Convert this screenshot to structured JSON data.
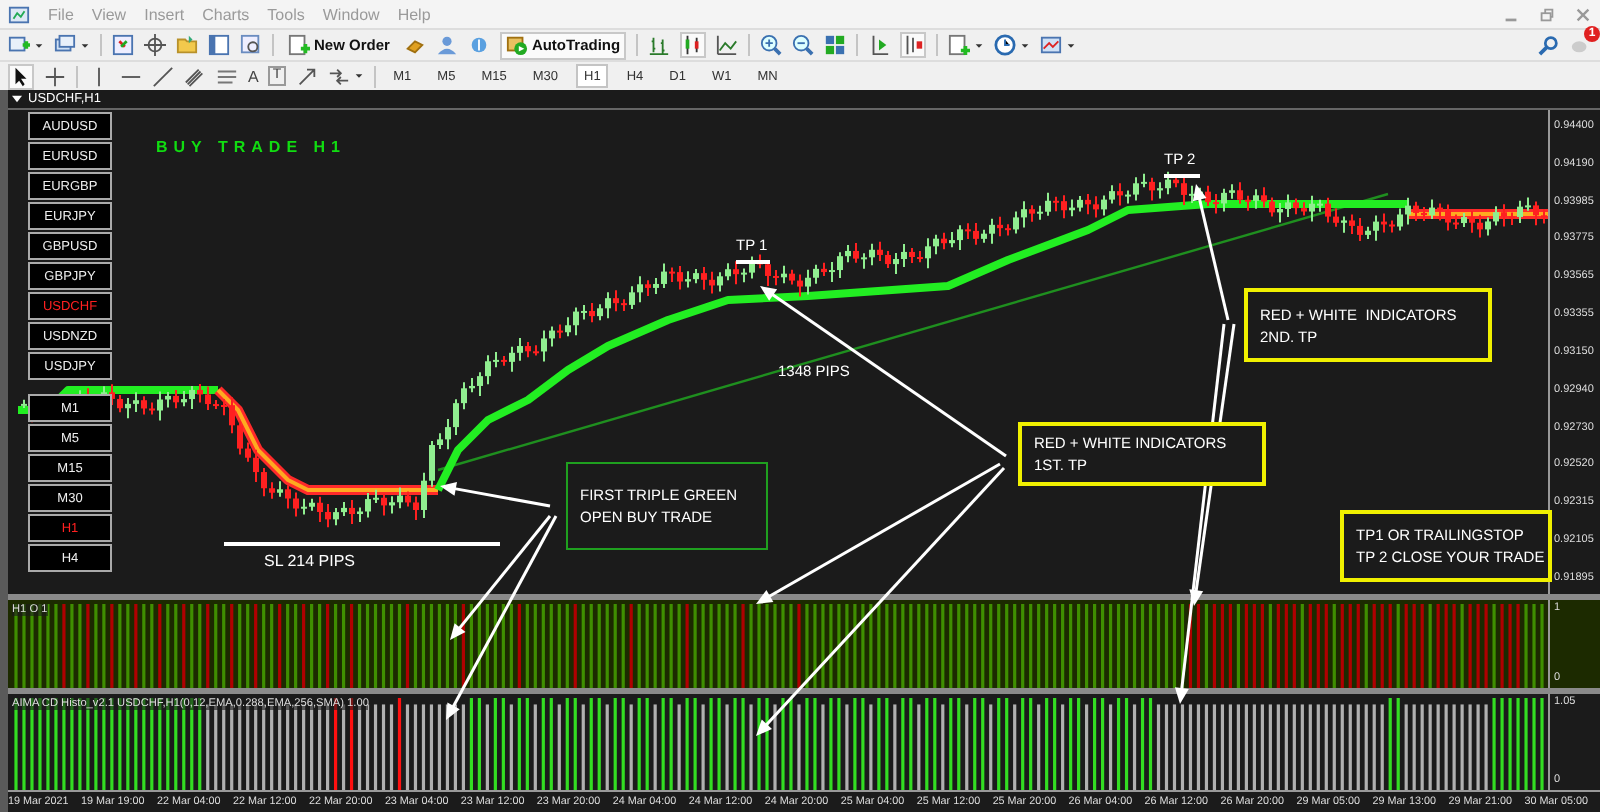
{
  "menu": [
    "File",
    "View",
    "Insert",
    "Charts",
    "Tools",
    "Window",
    "Help"
  ],
  "toolbar": {
    "new_order": "New Order",
    "autotrading": "AutoTrading",
    "notification_count": "1"
  },
  "drawing_tools": {
    "text_tool": "A",
    "label_tool": "T"
  },
  "timeframes": [
    {
      "label": "M1",
      "selected": false
    },
    {
      "label": "M5",
      "selected": false
    },
    {
      "label": "M15",
      "selected": false
    },
    {
      "label": "M30",
      "selected": false
    },
    {
      "label": "H1",
      "selected": true
    },
    {
      "label": "H4",
      "selected": false
    },
    {
      "label": "D1",
      "selected": false
    },
    {
      "label": "W1",
      "selected": false
    },
    {
      "label": "MN",
      "selected": false
    }
  ],
  "chart": {
    "title": "USDCHF,H1",
    "heading": "BUY TRADE H1",
    "symbols": [
      {
        "label": "AUDUSD",
        "selected": false
      },
      {
        "label": "EURUSD",
        "selected": false
      },
      {
        "label": "EURGBP",
        "selected": false
      },
      {
        "label": "EURJPY",
        "selected": false
      },
      {
        "label": "GBPUSD",
        "selected": false
      },
      {
        "label": "GBPJPY",
        "selected": false
      },
      {
        "label": "USDCHF",
        "selected": true
      },
      {
        "label": "USDNZD",
        "selected": false
      },
      {
        "label": "USDJPY",
        "selected": false
      }
    ],
    "periods": [
      {
        "label": "M1",
        "selected": false
      },
      {
        "label": "M5",
        "selected": false
      },
      {
        "label": "M15",
        "selected": false
      },
      {
        "label": "M30",
        "selected": false
      },
      {
        "label": "H1",
        "selected": true
      },
      {
        "label": "H4",
        "selected": false
      }
    ],
    "price_labels": [
      "0.94400",
      "0.94190",
      "0.93985",
      "0.93775",
      "0.93565",
      "0.93355",
      "0.93150",
      "0.92940",
      "0.92730",
      "0.92520",
      "0.92315",
      "0.92105",
      "0.91895"
    ],
    "tp1": "TP 1",
    "tp2": "TP 2",
    "pips": "1348 PIPS",
    "sl": "SL 214 PIPS",
    "notes": [
      {
        "kind": "entry",
        "lines": [
          "FIRST TRIPLE GREEN",
          "OPEN BUY TRADE"
        ]
      },
      {
        "kind": "target",
        "lines": [
          "RED + WHITE INDICATORS",
          "1ST. TP"
        ]
      },
      {
        "kind": "target",
        "lines": [
          "RED + WHITE  INDICATORS",
          "2ND. TP"
        ]
      },
      {
        "kind": "target",
        "lines": [
          "TP1 OR TRAILINGSTOP",
          "TP 2 CLOSE YOUR TRADE"
        ]
      }
    ]
  },
  "indicators": [
    {
      "kind": "signal",
      "label": "H1 O 1",
      "scale": [
        "1",
        "0"
      ]
    },
    {
      "kind": "histogram",
      "label": "AIMA CD Histo_v2.1 USDCHF,H1(0,12,EMA,0.288,EMA,256,SMA) 1.00",
      "scale": [
        "1.05",
        "0"
      ]
    }
  ],
  "time_labels": [
    "19 Mar 2021",
    "19 Mar 19:00",
    "22 Mar 04:00",
    "22 Mar 12:00",
    "22 Mar 20:00",
    "23 Mar 04:00",
    "23 Mar 12:00",
    "23 Mar 20:00",
    "24 Mar 04:00",
    "24 Mar 12:00",
    "24 Mar 20:00",
    "25 Mar 04:00",
    "25 Mar 12:00",
    "25 Mar 20:00",
    "26 Mar 04:00",
    "26 Mar 12:00",
    "26 Mar 20:00",
    "29 Mar 05:00",
    "29 Mar 13:00",
    "29 Mar 21:00",
    "30 Mar 05:00"
  ]
}
